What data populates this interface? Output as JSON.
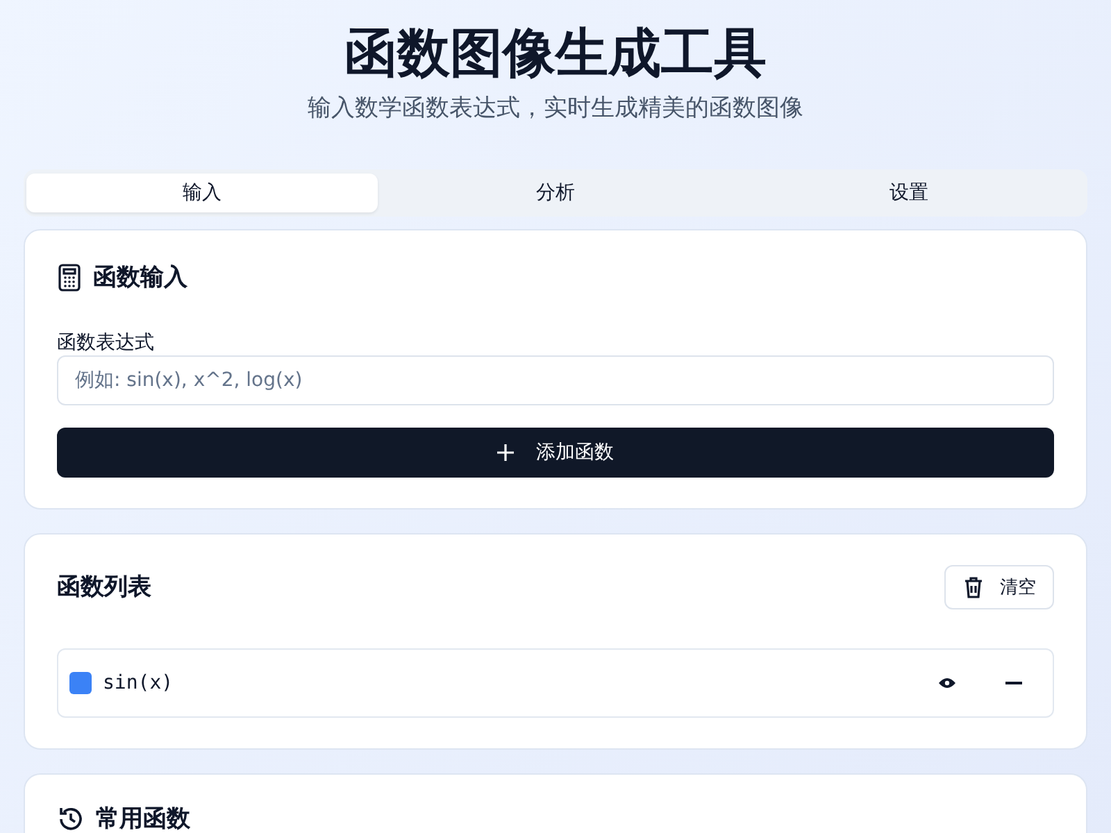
{
  "header": {
    "title": "函数图像生成工具",
    "subtitle": "输入数学函数表达式，实时生成精美的函数图像"
  },
  "tabs": [
    {
      "label": "输入",
      "selected": true
    },
    {
      "label": "分析",
      "selected": false
    },
    {
      "label": "设置",
      "selected": false
    }
  ],
  "input_card": {
    "title": "函数输入",
    "field_label": "函数表达式",
    "placeholder": "例如: sin(x), x^2, log(x)",
    "add_button": "添加函数"
  },
  "list_card": {
    "title": "函数列表",
    "clear_button": "清空",
    "functions": [
      {
        "expression": "sin(x)",
        "color": "#3b82f6",
        "visible": true
      }
    ]
  },
  "common_card": {
    "title": "常用函数"
  }
}
